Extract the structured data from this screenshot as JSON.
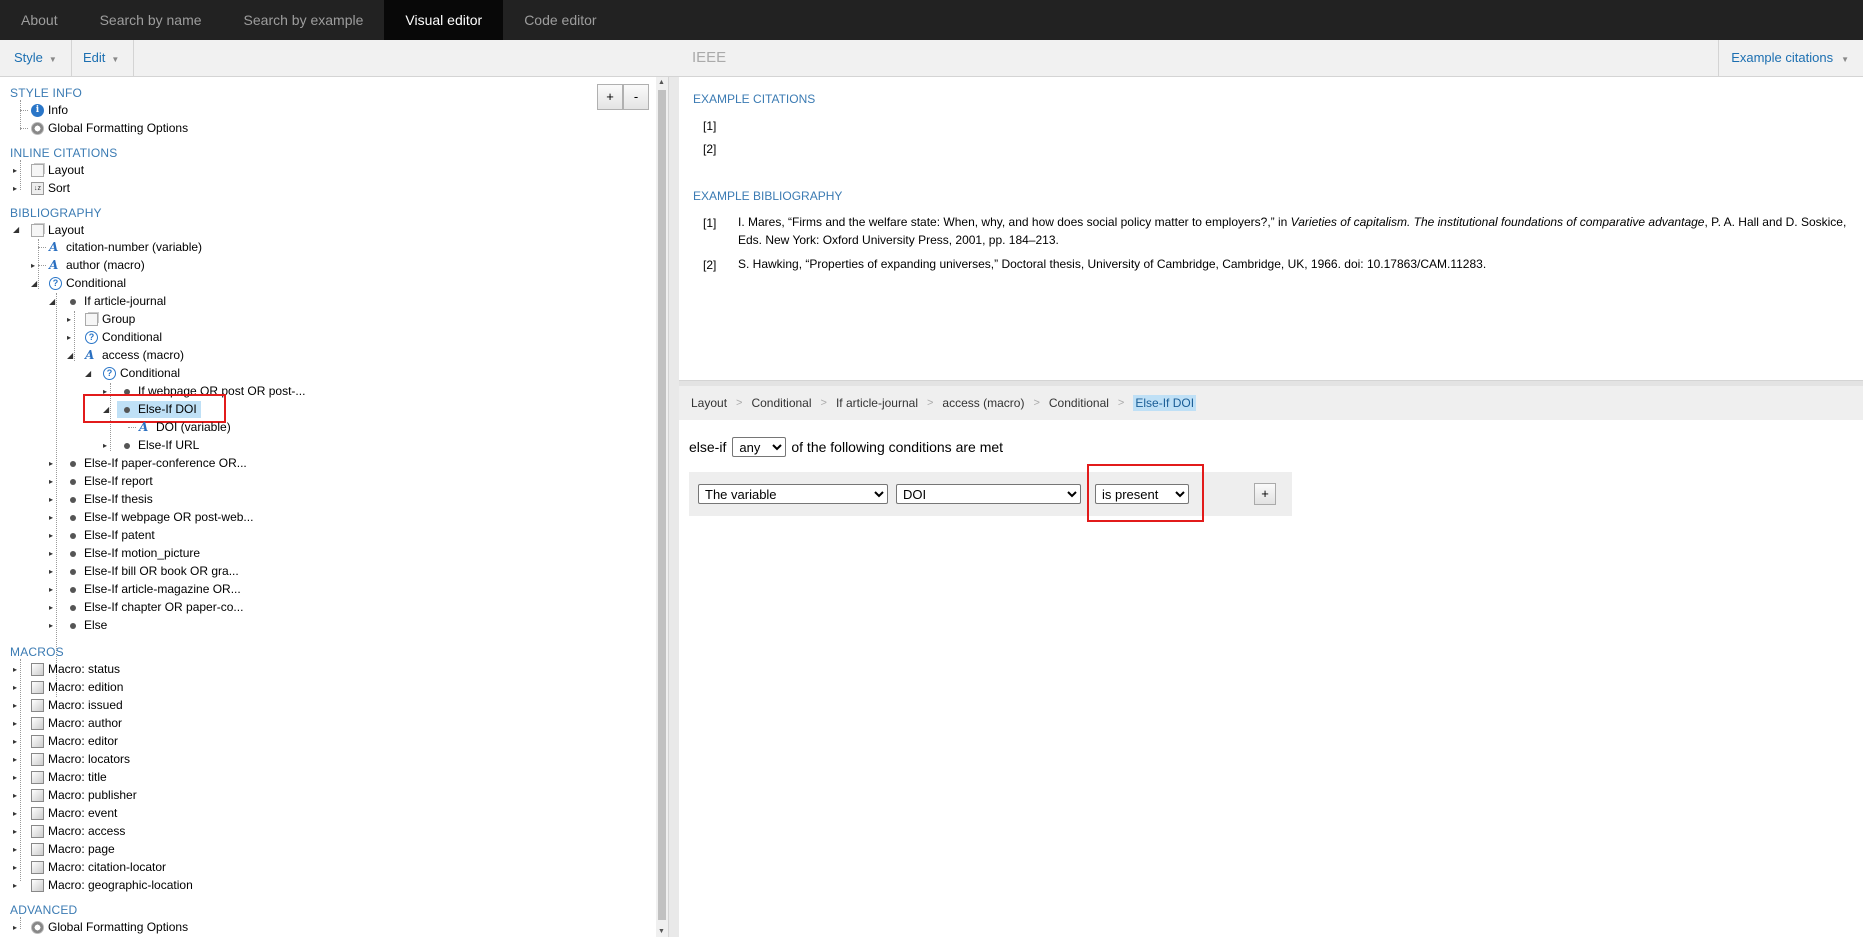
{
  "nav": {
    "tabs": [
      {
        "label": "About"
      },
      {
        "label": "Search by name"
      },
      {
        "label": "Search by example"
      },
      {
        "label": "Visual editor"
      },
      {
        "label": "Code editor"
      }
    ],
    "active": "Visual editor"
  },
  "toolbar": {
    "style_label": "Style",
    "edit_label": "Edit",
    "style_title": "IEEE",
    "example_citations_label": "Example citations"
  },
  "tree": {
    "zoom_in": "+",
    "zoom_out": "-",
    "style_info": {
      "heading": "STYLE INFO",
      "items": [
        "Info",
        "Global Formatting Options"
      ]
    },
    "inline_citations": {
      "heading": "INLINE CITATIONS",
      "items": [
        "Layout",
        "Sort"
      ]
    },
    "bibliography": {
      "heading": "BIBLIOGRAPHY",
      "layout": "Layout",
      "citation_number": "citation-number (variable)",
      "author_macro": "author (macro)",
      "conditional": "Conditional",
      "if_article_journal": "If article-journal",
      "group": "Group",
      "conditional_2": "Conditional",
      "access_macro": "access (macro)",
      "conditional_3": "Conditional",
      "if_webpage": "If webpage OR post OR post-...",
      "elseif_doi": "Else-If DOI",
      "doi_variable": "DOI (variable)",
      "elseif_url": "Else-If URL",
      "elseifs": [
        "Else-If paper-conference OR...",
        "Else-If report",
        "Else-If thesis",
        "Else-If webpage OR post-web...",
        "Else-If patent",
        "Else-If motion_picture",
        "Else-If bill OR book OR gra...",
        "Else-If article-magazine OR...",
        "Else-If chapter OR paper-co...",
        "Else"
      ]
    },
    "macros": {
      "heading": "MACROS",
      "items": [
        "Macro: status",
        "Macro: edition",
        "Macro: issued",
        "Macro: author",
        "Macro: editor",
        "Macro: locators",
        "Macro: title",
        "Macro: publisher",
        "Macro: event",
        "Macro: access",
        "Macro: page",
        "Macro: citation-locator",
        "Macro: geographic-location"
      ]
    },
    "advanced": {
      "heading": "ADVANCED",
      "items": [
        "Global Formatting Options"
      ]
    }
  },
  "examples": {
    "citations_heading": "EXAMPLE CITATIONS",
    "citations": [
      "[1]",
      "[2]"
    ],
    "bibliography_heading": "EXAMPLE BIBLIOGRAPHY",
    "bibliography": [
      {
        "num": "[1]",
        "pre": "I. Mares, “Firms and the welfare state: When, why, and how does social policy matter to employers?,” in ",
        "italic": "Varieties of capitalism. The institutional foundations of comparative advantage",
        "post": ", P. A. Hall and D. Soskice, Eds. New York: Oxford University Press, 2001, pp. 184–213."
      },
      {
        "num": "[2]",
        "text": "S. Hawking, “Properties of expanding universes,” Doctoral thesis, University of Cambridge, Cambridge, UK, 1966. doi: 10.17863/CAM.11283."
      }
    ]
  },
  "breadcrumb": [
    "Layout",
    "Conditional",
    "If article-journal",
    "access (macro)",
    "Conditional",
    "Else-If DOI"
  ],
  "editor": {
    "prefix": "else-if",
    "match_value": "any",
    "suffix": "of the following conditions are met",
    "condition": {
      "type": "The variable",
      "variable": "DOI",
      "test": "is present"
    },
    "add_label": "+"
  },
  "colors": {
    "nav_bg": "#222222",
    "accent": "#3b7bb3",
    "selection": "#bfe0f6",
    "highlight": "#e21b1b"
  }
}
